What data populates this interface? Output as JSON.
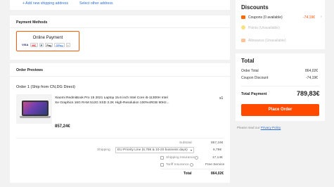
{
  "top": {
    "add_address": "+ Add new shipping address",
    "select_other": "Select other address"
  },
  "payment": {
    "title": "Payment Methods",
    "option_label": "Online Payment",
    "icons": [
      "VISA",
      "MC",
      "P",
      "Pay",
      "GPay",
      "+"
    ]
  },
  "order": {
    "title": "Order Previews",
    "subtitle": "Order 1 (Ship from CN,DG Direct)",
    "product_name_line1": "Xiaomi RedmiBook Pro 15 2021 Laptop 15.6 inch Intel Core i5-11300H Intel",
    "product_name_line2": "Xe Graphics 16G RAM 512G SSD 3.2K High-Resolution 100%sRGB 90Hz...",
    "quantity": "x1",
    "price": "857,24€",
    "subtotal_label": "Subtotal",
    "subtotal_value": "857,24€",
    "shipping_label": "Shipping",
    "shipping_option": "EU Priority Line (6,78€ & 10-20 business days)",
    "shipping_value": "6,78€",
    "insurance_label": "Shipping Insurance",
    "insurance_value": "17,14€",
    "tariff_label": "Tariff Insurance",
    "tariff_value": "Free Service",
    "total_label": "Total",
    "total_value": "864,02€"
  },
  "discounts": {
    "title": "Discounts",
    "coupons_label": "Coupons (0 available)",
    "coupons_value": "-74,19€",
    "points_label": "Points (Unavailable)",
    "allowance_label": "Allowance (Unavailable)"
  },
  "totals": {
    "title": "Total",
    "order_total_label": "Order Total",
    "order_total_value": "864,02€",
    "coupon_discount_label": "Coupon Discount",
    "coupon_discount_value": "-74,19€",
    "total_payment_label": "Total Payment",
    "total_payment_value": "789,83€",
    "place_order": "Place Order"
  },
  "policy": {
    "prefix": "Please read our",
    "link": "Privacy Policy"
  },
  "colors": {
    "accent": "#ff4a00",
    "link": "#2f6fd6"
  }
}
